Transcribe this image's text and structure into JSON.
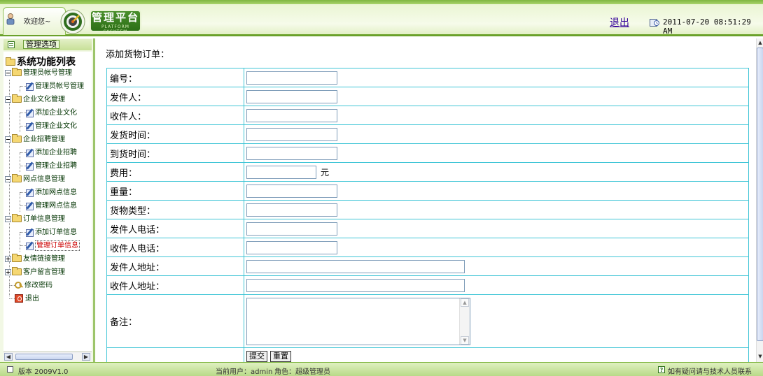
{
  "header": {
    "welcome": "欢迎您~",
    "logo_title": "管理平台",
    "logo_subtitle": "PLATFORM SYSYTEM",
    "logout": "退出",
    "datetime": "2011-07-20 08:51:29 AM",
    "colors": {
      "brand_green": "#2c6f17",
      "header_bg": "#eaf5d3",
      "link": "#330099"
    }
  },
  "sidebar": {
    "title": "管理选项",
    "root": "系统功能列表",
    "groups": [
      {
        "label": "管理员帐号管理",
        "expanded": true,
        "items": [
          {
            "label": "管理员帐号管理"
          }
        ]
      },
      {
        "label": "企业文化管理",
        "expanded": true,
        "items": [
          {
            "label": "添加企业文化"
          },
          {
            "label": "管理企业文化"
          }
        ]
      },
      {
        "label": "企业招聘管理",
        "expanded": true,
        "items": [
          {
            "label": "添加企业招聘"
          },
          {
            "label": "管理企业招聘"
          }
        ]
      },
      {
        "label": "网点信息管理",
        "expanded": true,
        "items": [
          {
            "label": "添加网点信息"
          },
          {
            "label": "管理网点信息"
          }
        ]
      },
      {
        "label": "订单信息管理",
        "expanded": true,
        "items": [
          {
            "label": "添加订单信息"
          },
          {
            "label": "管理订单信息"
          }
        ]
      },
      {
        "label": "友情链接管理",
        "expanded": false,
        "items": []
      },
      {
        "label": "客户留言管理",
        "expanded": false,
        "items": []
      }
    ],
    "change_password": "修改密码",
    "exit": "退出",
    "active_item": "管理订单信息"
  },
  "main": {
    "page_title": "添加货物订单：",
    "fields": [
      {
        "label": "编号：",
        "value": ""
      },
      {
        "label": "发件人：",
        "value": ""
      },
      {
        "label": "收件人：",
        "value": ""
      },
      {
        "label": "发货时间：",
        "value": ""
      },
      {
        "label": "到货时间：",
        "value": ""
      },
      {
        "label": "费用：",
        "value": "",
        "unit": "元"
      },
      {
        "label": "重量：",
        "value": ""
      },
      {
        "label": "货物类型：",
        "value": ""
      },
      {
        "label": "发件人电话：",
        "value": ""
      },
      {
        "label": "收件人电话：",
        "value": ""
      },
      {
        "label": "发件人地址：",
        "value": ""
      },
      {
        "label": "收件人地址：",
        "value": ""
      }
    ],
    "remark_label": "备注：",
    "remark_value": "",
    "submit": "提交",
    "reset": "重置",
    "table_border_color": "#3fc5d6"
  },
  "footer": {
    "version": "版本 2009V1.0",
    "current_user": "当前用户：admin",
    "role": "角色：超级管理员",
    "help": "如有疑问请与技术人员联系"
  }
}
